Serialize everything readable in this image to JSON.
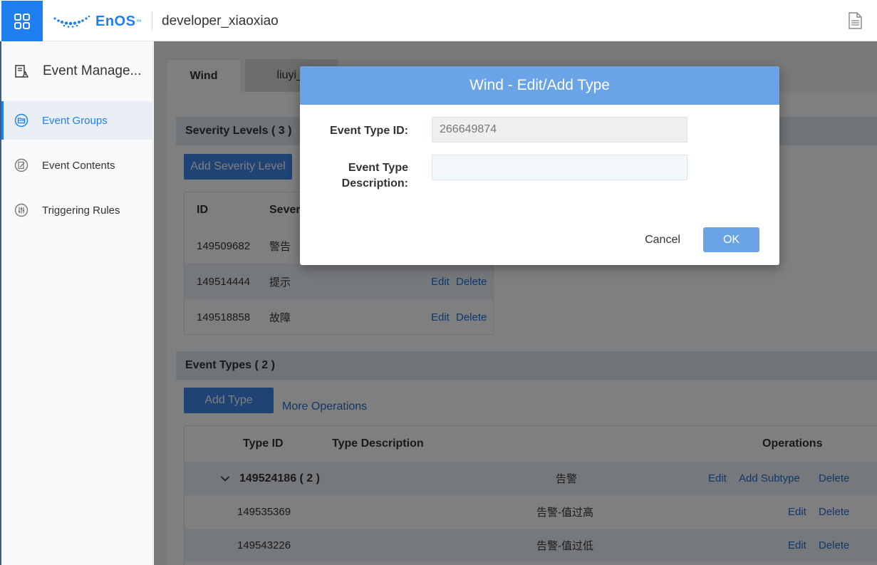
{
  "header": {
    "logo_text": "EnOS",
    "logo_tm": "™",
    "org_name": "developer_xiaoxiao"
  },
  "sidebar": {
    "title": "Event Manage...",
    "items": [
      {
        "label": "Event Groups",
        "icon": "folder-icon",
        "active": true
      },
      {
        "label": "Event Contents",
        "icon": "edit-doc-icon",
        "active": false
      },
      {
        "label": "Triggering Rules",
        "icon": "sliders-icon",
        "active": false
      }
    ]
  },
  "tabs": [
    {
      "label": "Wind",
      "active": true
    },
    {
      "label": "liuyi_t",
      "active": false
    }
  ],
  "severity": {
    "title": "Severity Levels ( 3 )",
    "add_label": "Add Severity Level",
    "columns": [
      "ID",
      "Sever"
    ],
    "rows": [
      {
        "id": "149509682",
        "name": "警告",
        "edit": "",
        "delete": ""
      },
      {
        "id": "149514444",
        "name": "提示",
        "edit": "Edit",
        "delete": "Delete"
      },
      {
        "id": "149518858",
        "name": "故障",
        "edit": "Edit",
        "delete": "Delete"
      }
    ]
  },
  "event_types": {
    "title": "Event Types ( 2 )",
    "add_label": "Add Type",
    "more_label": "More Operations",
    "columns": {
      "type_id": "Type ID",
      "type_desc": "Type Description",
      "operations": "Operations"
    },
    "group": {
      "id": "149524186 ( 2 )",
      "desc": "告警",
      "edit": "Edit",
      "add_subtype": "Add Subtype",
      "delete": "Delete"
    },
    "rows": [
      {
        "id": "149535369",
        "desc": "告警-值过高",
        "edit": "Edit",
        "delete": "Delete"
      },
      {
        "id": "149543226",
        "desc": "告警-值过低",
        "edit": "Edit",
        "delete": "Delete"
      }
    ]
  },
  "modal": {
    "title": "Wind - Edit/Add Type",
    "type_id_label": "Event Type ID:",
    "type_id_value": "266649874",
    "desc_label_line1": "Event Type",
    "desc_label_line2": "Description:",
    "desc_value": "",
    "cancel_label": "Cancel",
    "ok_label": "OK"
  },
  "colors": {
    "brand": "#1f7ff0",
    "modal_header": "#6aa3e6",
    "primary_button": "#3d86e8"
  }
}
